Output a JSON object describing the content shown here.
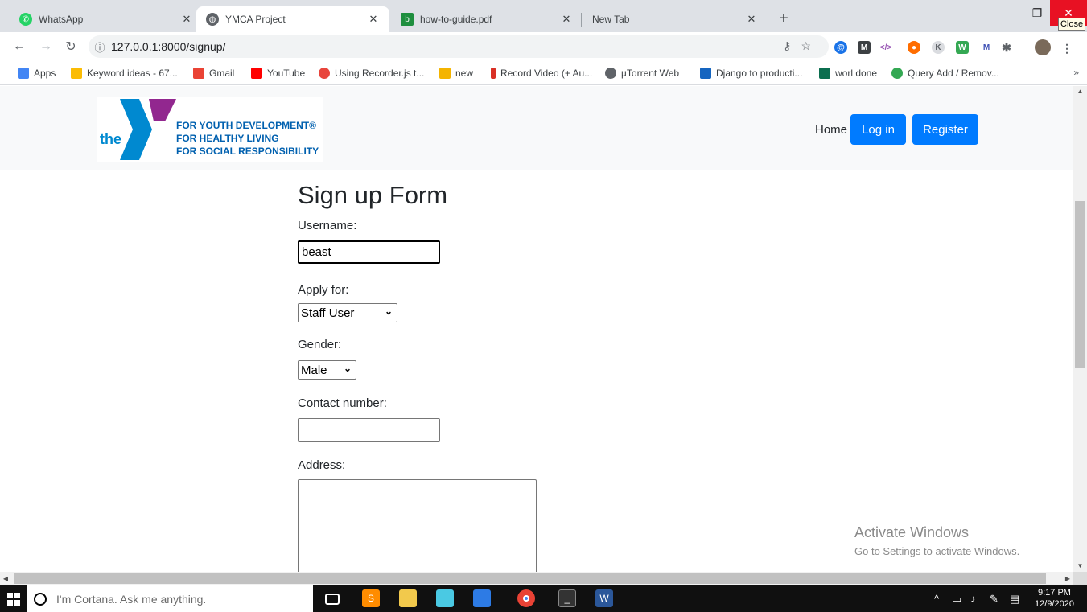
{
  "browser": {
    "tabs": [
      {
        "label": "WhatsApp",
        "icon": "whatsapp-icon",
        "color": "#25d366",
        "active": false
      },
      {
        "label": "YMCA Project",
        "icon": "globe-icon",
        "color": "#5f6368",
        "active": true
      },
      {
        "label": "how-to-guide.pdf",
        "icon": "pdf-icon",
        "color": "#1e8e3e",
        "active": false
      },
      {
        "label": "New Tab",
        "icon": "",
        "color": "",
        "active": false
      }
    ],
    "new_tab": "+",
    "close_tooltip": "Close",
    "url": "127.0.0.1:8000/signup/",
    "bookmarks": [
      {
        "label": "Apps",
        "color": "#4285f4"
      },
      {
        "label": "Keyword ideas - 67...",
        "color": "#fbbc04"
      },
      {
        "label": "Gmail",
        "color": "#ea4335"
      },
      {
        "label": "YouTube",
        "color": "#ff0000"
      },
      {
        "label": "Using Recorder.js t...",
        "color": "#e8453c"
      },
      {
        "label": "new",
        "color": "#f4b400"
      },
      {
        "label": "Record Video (+ Au...",
        "color": "#d93025"
      },
      {
        "label": "µTorrent Web",
        "color": "#5f6368"
      },
      {
        "label": "Django to producti...",
        "color": "#1565c0"
      },
      {
        "label": "worl done",
        "color": "#0b6e4f"
      },
      {
        "label": "Query Add / Remov...",
        "color": "#34a853"
      }
    ],
    "bookmarks_more": "»"
  },
  "site": {
    "logo": {
      "word": "the",
      "taglines": [
        "FOR YOUTH DEVELOPMENT®",
        "FOR HEALTHY LIVING",
        "FOR SOCIAL RESPONSIBILITY"
      ],
      "brand_blue": "#0089d0",
      "brand_purple": "#92278f"
    },
    "nav": {
      "home": "Home",
      "login": "Log in",
      "register": "Register"
    },
    "primary_color": "#007bff"
  },
  "form": {
    "title": "Sign up Form",
    "username_label": "Username:",
    "username_value": "beast",
    "apply_label": "Apply for:",
    "apply_value": "Staff User",
    "gender_label": "Gender:",
    "gender_value": "Male",
    "contact_label": "Contact number:",
    "contact_value": "",
    "address_label": "Address:"
  },
  "watermark": {
    "line1": "Activate Windows",
    "line2": "Go to Settings to activate Windows."
  },
  "taskbar": {
    "search_placeholder": "I'm Cortana. Ask me anything.",
    "time": "9:17 PM",
    "date": "12/9/2020"
  }
}
